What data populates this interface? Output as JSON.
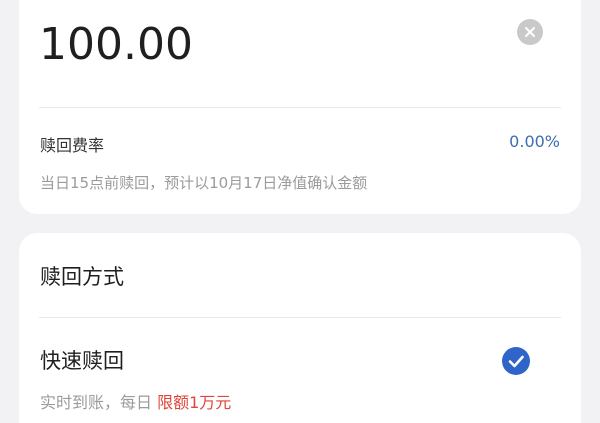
{
  "amount": {
    "value": "100.00"
  },
  "fee": {
    "label": "赎回费率",
    "rate": "0.00%",
    "note": "当日15点前赎回，预计以10月17日净值确认金额"
  },
  "method": {
    "section_title": "赎回方式",
    "option": {
      "title": "快速赎回",
      "desc_prefix": "实时到账，每日",
      "desc_limit": "限额1万元"
    }
  },
  "colors": {
    "accent_blue": "#3b6fb0",
    "check_blue": "#2f64c8",
    "limit_red": "#e0443a"
  },
  "icons": {
    "clear": "clear-icon",
    "check": "check-circle-icon"
  }
}
